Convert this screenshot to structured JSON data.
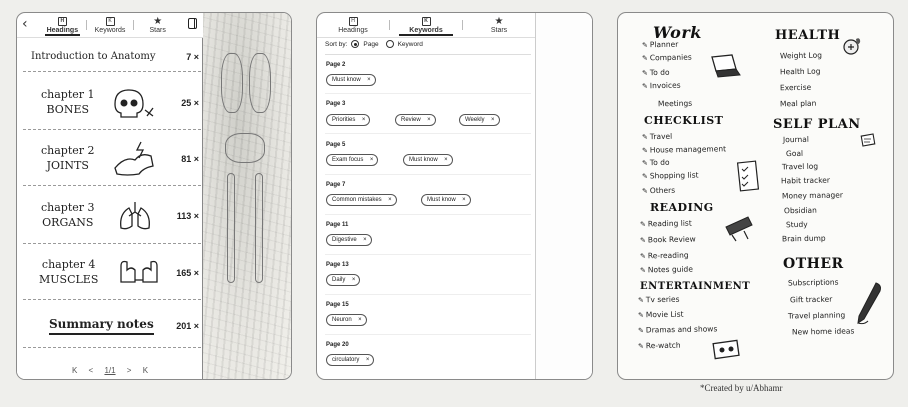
{
  "tabs": [
    {
      "label": "Headings",
      "icon": "H"
    },
    {
      "label": "Keywords",
      "icon": "K"
    },
    {
      "label": "Stars",
      "icon": "★"
    }
  ],
  "toc": {
    "items": [
      {
        "title": "Introduction to Anatomy",
        "page": "7 ×"
      },
      {
        "title": "chapter 1\nBONES",
        "page": "25 ×"
      },
      {
        "title": "chapter 2\nJOINTS",
        "page": "81 ×"
      },
      {
        "title": "chapter 3\nORGANS",
        "page": "113 ×"
      },
      {
        "title": "chapter 4\nMUSCLES",
        "page": "165 ×"
      },
      {
        "title": "Summary notes",
        "page": "201 ×"
      }
    ],
    "pager": {
      "first": "K",
      "prev": "<",
      "page": "1/1",
      "next": ">",
      "last": "K"
    }
  },
  "keywords": {
    "sort_label": "Sort by:",
    "sort_options": [
      "Page",
      "Keyword"
    ],
    "groups": [
      {
        "page": "Page 2",
        "chips": [
          "Must know"
        ]
      },
      {
        "page": "Page 3",
        "chips": [
          "Priorities",
          "Review",
          "Weekly"
        ]
      },
      {
        "page": "Page 5",
        "chips": [
          "Exam focus",
          "Must know"
        ]
      },
      {
        "page": "Page 7",
        "chips": [
          "Common mistakes",
          "Must know"
        ]
      },
      {
        "page": "Page 11",
        "chips": [
          "Digestive"
        ]
      },
      {
        "page": "Page 13",
        "chips": [
          "Daily"
        ]
      },
      {
        "page": "Page 15",
        "chips": [
          "Neuron"
        ]
      },
      {
        "page": "Page 20",
        "chips": [
          "circulatory"
        ]
      }
    ]
  },
  "notebook": {
    "work": {
      "title": "Work",
      "items": [
        "Planner",
        "Companies",
        "To do",
        "Invoices",
        "Meetings"
      ]
    },
    "checklist": {
      "title": "CHECKLIST",
      "items": [
        "Travel",
        "House management",
        "To do",
        "Shopping list",
        "Others"
      ]
    },
    "reading": {
      "title": "READING",
      "items": [
        "Reading list",
        "Book Review",
        "Re-reading",
        "Notes guide"
      ]
    },
    "entertainment": {
      "title": "ENTERTAINMENT",
      "items": [
        "Tv series",
        "Movie List",
        "Dramas and shows",
        "Re-watch"
      ]
    },
    "health": {
      "title": "HEALTH",
      "items": [
        "Weight Log",
        "Health Log",
        "Exercise",
        "Meal plan"
      ]
    },
    "self_plan": {
      "title": "SELF PLAN",
      "items": [
        "Journal",
        "Goal",
        "Travel log",
        "Habit tracker",
        "Money manager",
        "Obsidian",
        "Study",
        "Brain dump"
      ]
    },
    "other": {
      "title": "OTHER",
      "items": [
        "Subscriptions",
        "Gift tracker",
        "Travel planning",
        "New home ideas"
      ]
    }
  },
  "credit": "*Created by u/Abhamr"
}
